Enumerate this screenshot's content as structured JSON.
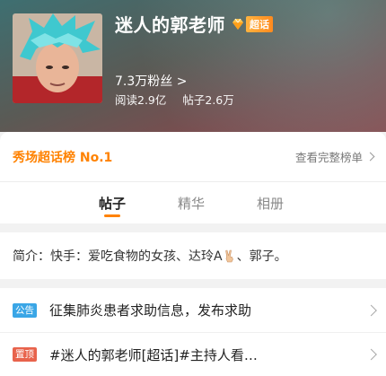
{
  "header": {
    "title": "迷人的郭老师",
    "badge_label": "超话",
    "fans": "7.3万粉丝 >",
    "reads": "阅读2.9亿",
    "posts": "帖子2.6万"
  },
  "rank": {
    "label": "秀场超话榜 No.1",
    "link": "查看完整榜单"
  },
  "tabs": [
    {
      "label": "帖子",
      "active": true
    },
    {
      "label": "精华",
      "active": false
    },
    {
      "label": "相册",
      "active": false
    }
  ],
  "intro": {
    "prefix": "简介：快手：爱吃食物的女孩、达玲A",
    "suffix": "、郭子。"
  },
  "list": [
    {
      "tag": "公告",
      "text": "征集肺炎患者求助信息，发布求助"
    },
    {
      "tag": "置顶",
      "text": "#迷人的郭老师[超话]#主持人看…"
    }
  ],
  "colors": {
    "accent": "#ff8200",
    "notice_tag": "#3aa6e6",
    "top_tag": "#e8634c"
  },
  "icons": [
    "diamond-icon",
    "chevron-right-icon",
    "victory-hand-icon"
  ]
}
